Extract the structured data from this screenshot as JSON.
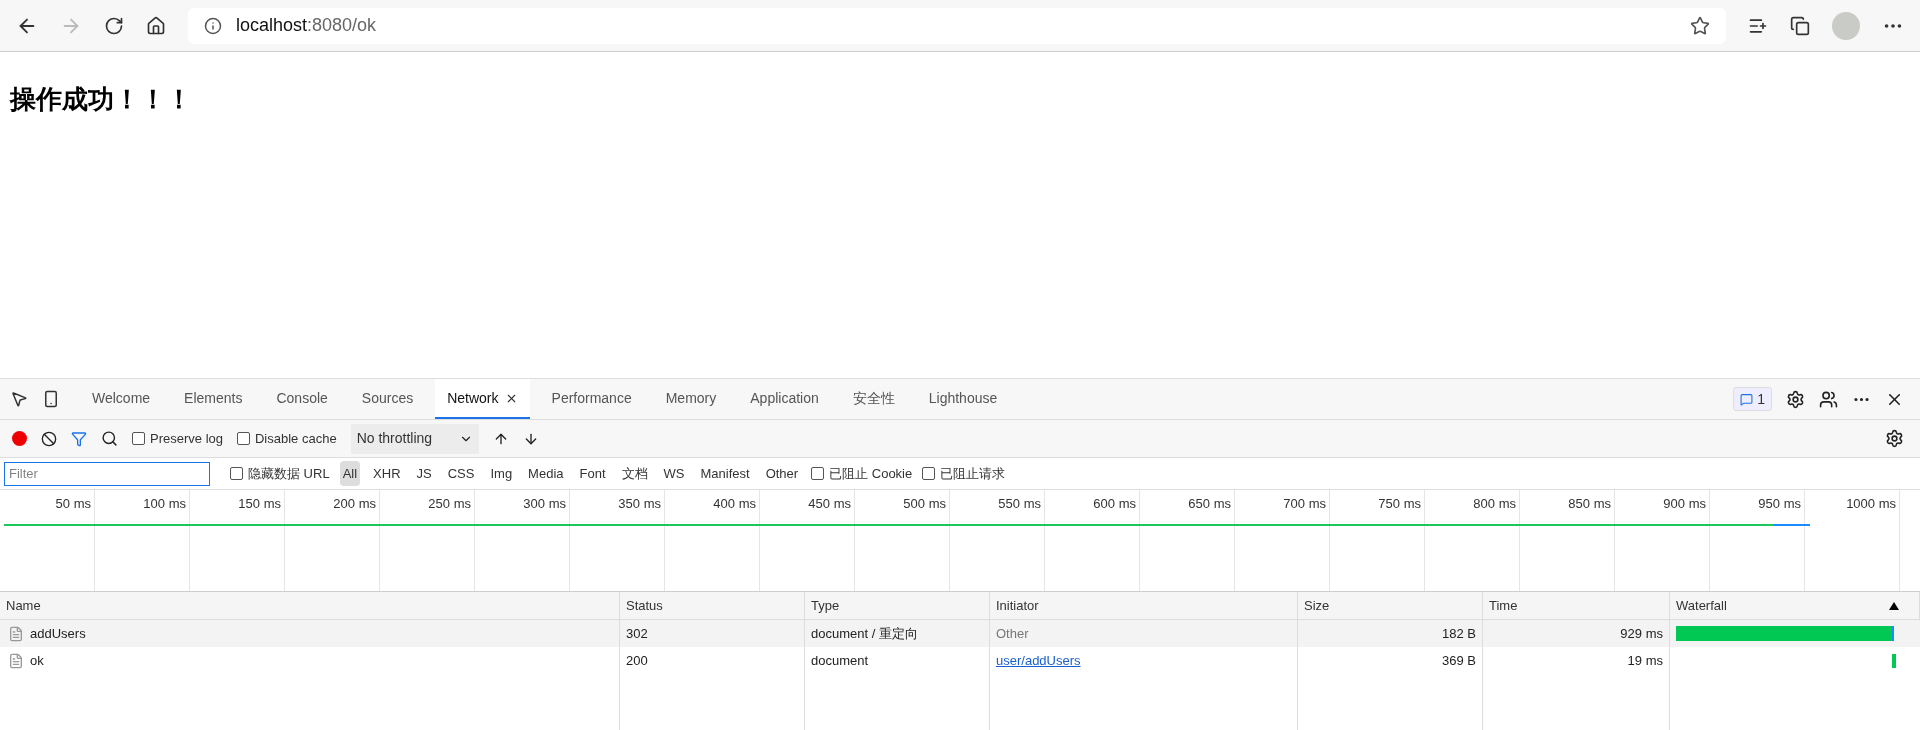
{
  "browser": {
    "url_host": "localhost",
    "url_rest": ":8080/ok"
  },
  "page": {
    "heading": "操作成功！！！"
  },
  "devtools": {
    "tabs": [
      {
        "label": "Welcome",
        "selected": false
      },
      {
        "label": "Elements",
        "selected": false
      },
      {
        "label": "Console",
        "selected": false
      },
      {
        "label": "Sources",
        "selected": false
      },
      {
        "label": "Network",
        "selected": true
      },
      {
        "label": "Performance",
        "selected": false
      },
      {
        "label": "Memory",
        "selected": false
      },
      {
        "label": "Application",
        "selected": false
      },
      {
        "label": "安全性",
        "selected": false
      },
      {
        "label": "Lighthouse",
        "selected": false
      }
    ],
    "issues_count": "1",
    "toolbar": {
      "recording": true,
      "filter_on": true,
      "preserve_log": {
        "label": "Preserve log",
        "checked": false
      },
      "disable_cache": {
        "label": "Disable cache",
        "checked": false
      },
      "throttling": "No throttling"
    },
    "filter": {
      "placeholder": "Filter",
      "hide_data_urls": {
        "label": "隐藏数据 URL",
        "checked": false
      },
      "types": [
        {
          "label": "All",
          "selected": true
        },
        {
          "label": "XHR",
          "selected": false
        },
        {
          "label": "JS",
          "selected": false
        },
        {
          "label": "CSS",
          "selected": false
        },
        {
          "label": "Img",
          "selected": false
        },
        {
          "label": "Media",
          "selected": false
        },
        {
          "label": "Font",
          "selected": false
        },
        {
          "label": "文档",
          "selected": false
        },
        {
          "label": "WS",
          "selected": false
        },
        {
          "label": "Manifest",
          "selected": false
        },
        {
          "label": "Other",
          "selected": false
        }
      ],
      "blocked_cookies": {
        "label": "已阻止 Cookie",
        "checked": false
      },
      "blocked_requests": {
        "label": "已阻止请求",
        "checked": false
      }
    },
    "timeline": {
      "ticks": [
        "50 ms",
        "100 ms",
        "150 ms",
        "200 ms",
        "250 ms",
        "300 ms",
        "350 ms",
        "400 ms",
        "450 ms",
        "500 ms",
        "550 ms",
        "600 ms",
        "650 ms",
        "700 ms",
        "750 ms",
        "800 ms",
        "850 ms",
        "900 ms",
        "950 ms",
        "1000 ms"
      ]
    },
    "table": {
      "columns": [
        "Name",
        "Status",
        "Type",
        "Initiator",
        "Size",
        "Time",
        "Waterfall"
      ],
      "rows": [
        {
          "name": "addUsers",
          "status": "302",
          "type": "document / 重定向",
          "initiator": "Other",
          "kind": "text",
          "size": "182 B",
          "time": "929 ms",
          "selected": true
        },
        {
          "name": "ok",
          "status": "200",
          "type": "document",
          "initiator": "user/addUsers",
          "kind": "link",
          "size": "369 B",
          "time": "19 ms",
          "selected": false
        }
      ]
    }
  }
}
